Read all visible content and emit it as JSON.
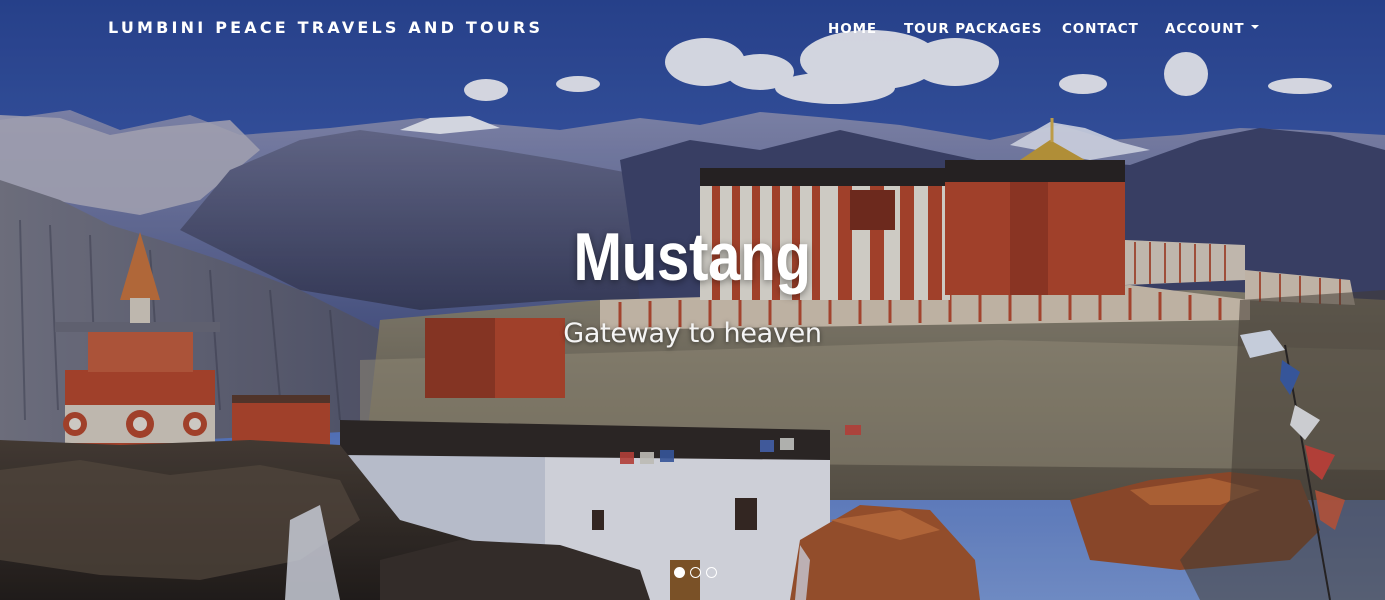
{
  "navbar": {
    "brand": "LUMBINI PEACE TRAVELS AND TOURS",
    "items": [
      {
        "label": "HOME"
      },
      {
        "label": "TOUR PACKAGES"
      },
      {
        "label": "CONTACT"
      },
      {
        "label": "ACCOUNT",
        "dropdown": true
      }
    ]
  },
  "carousel": {
    "slide": {
      "title": "Mustang",
      "subtitle": "Gateway to heaven",
      "background": "mountain-monastery-photo"
    },
    "slide_count": 3,
    "active_index": 0
  },
  "colors": {
    "sky_top": "#2e4a9a",
    "sky_bottom": "#6b8ed1",
    "monastery_red": "#b5472a",
    "text": "#ffffff"
  },
  "icons": [
    "caret-down-icon"
  ]
}
